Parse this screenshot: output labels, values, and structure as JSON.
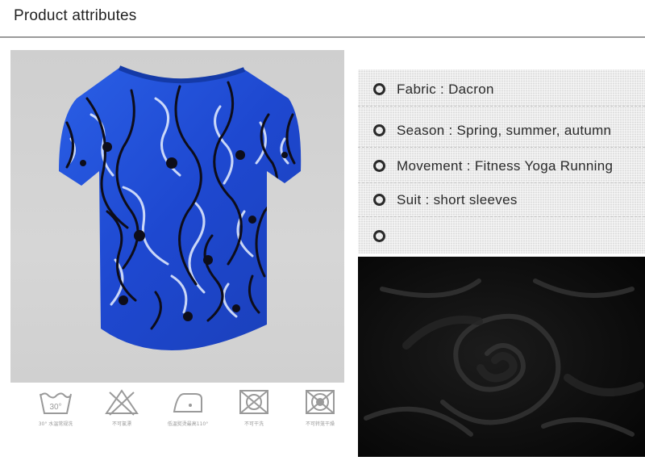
{
  "header": {
    "title": "Product attributes"
  },
  "attributes": [
    {
      "label": "Fabric",
      "value": "Dacron"
    },
    {
      "label": "Season",
      "value": "Spring, summer, autumn"
    },
    {
      "label": "Movement",
      "value": "Fitness Yoga Running"
    },
    {
      "label": "Suit",
      "value": "short sleeves"
    },
    {
      "label": "",
      "value": ""
    }
  ],
  "attribute_text": [
    "Fabric : Dacron",
    "Season : Spring, summer, autumn",
    "Movement : Fitness Yoga Running",
    "Suit : short sleeves",
    ""
  ],
  "care_symbols": [
    {
      "icon": "wash-30-icon",
      "badge": "30°",
      "caption": "30° 水温常规洗"
    },
    {
      "icon": "no-bleach-icon",
      "caption": "不可氯漂"
    },
    {
      "icon": "iron-low-icon",
      "caption": "低温熨烫最高110°"
    },
    {
      "icon": "no-tumble-dry-icon",
      "caption": "不可干洗"
    },
    {
      "icon": "no-dry-clean-icon",
      "caption": "不可转笼干燥"
    }
  ],
  "colors": {
    "shirt_blue": "#1f4fd6",
    "fabric_black": "#0a0a0a",
    "photo_background": "#d0d0d0"
  }
}
